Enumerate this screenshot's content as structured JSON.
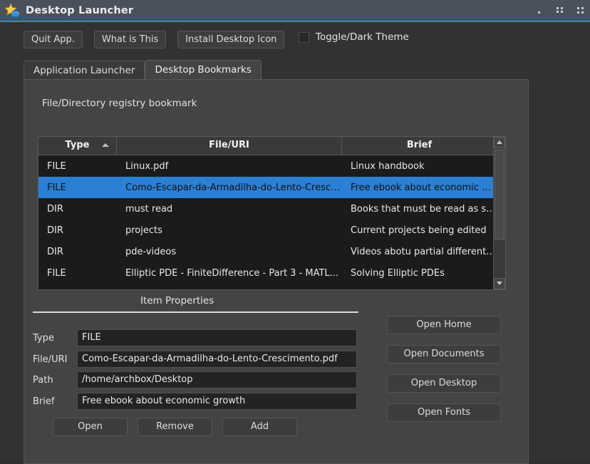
{
  "window": {
    "title": "Desktop Launcher",
    "icon": "star-database-icon",
    "controls": [
      {
        "name": "minimize",
        "glyph": "minimize-icon"
      },
      {
        "name": "maximize",
        "glyph": "maximize-icon"
      },
      {
        "name": "close",
        "glyph": "close-icon"
      }
    ],
    "accent_color": "#1e90d2",
    "titlebar_color": "#4a515b"
  },
  "toolbar": {
    "buttons": [
      {
        "label": "Quit App."
      },
      {
        "label": "What is This"
      },
      {
        "label": "Install Desktop Icon"
      }
    ],
    "theme_toggle": {
      "label": "Toggle/Dark Theme",
      "checked": false
    }
  },
  "tabs": [
    {
      "label": "Application Launcher",
      "active": false
    },
    {
      "label": "Desktop Bookmarks",
      "active": true
    }
  ],
  "panel": {
    "caption": "File/Directory registry bookmark",
    "table": {
      "columns": [
        {
          "label": "Type",
          "sort": "asc"
        },
        {
          "label": "File/URI",
          "sort": null
        },
        {
          "label": "Brief",
          "sort": null
        }
      ],
      "rows": [
        {
          "type": "FILE",
          "uri": "Linux.pdf",
          "brief": "Linux handbook",
          "selected": false
        },
        {
          "type": "FILE",
          "uri": "Como-Escapar-da-Armadilha-do-Lento-Cresci...",
          "brief": "Free ebook about economic gr...",
          "selected": true
        },
        {
          "type": "DIR",
          "uri": "must read",
          "brief": "Books that must be read as so...",
          "selected": false
        },
        {
          "type": "DIR",
          "uri": "projects",
          "brief": "Current projects being edited",
          "selected": false
        },
        {
          "type": "DIR",
          "uri": "pde-videos",
          "brief": "Videos abotu partial differenti...",
          "selected": false
        },
        {
          "type": "FILE",
          "uri": "Elliptic PDE - FiniteDifference - Part 3 - MATL...",
          "brief": "Solving Elliptic PDEs",
          "selected": false
        }
      ],
      "selection_color": "#2b7fd4"
    },
    "properties": {
      "title": "Item Properties",
      "fields": [
        {
          "label": "Type",
          "value": "FILE"
        },
        {
          "label": "File/URI",
          "value": "Como-Escapar-da-Armadilha-do-Lento-Crescimento.pdf"
        },
        {
          "label": "Path",
          "value": "/home/archbox/Desktop"
        },
        {
          "label": "Brief",
          "value": "Free ebook about economic growth"
        }
      ]
    },
    "actions": [
      {
        "label": "Open"
      },
      {
        "label": "Remove"
      },
      {
        "label": "Add"
      }
    ],
    "shortcuts": [
      {
        "label": "Open Home"
      },
      {
        "label": "Open Documents"
      },
      {
        "label": "Open Desktop"
      },
      {
        "label": "Open Fonts"
      }
    ]
  }
}
